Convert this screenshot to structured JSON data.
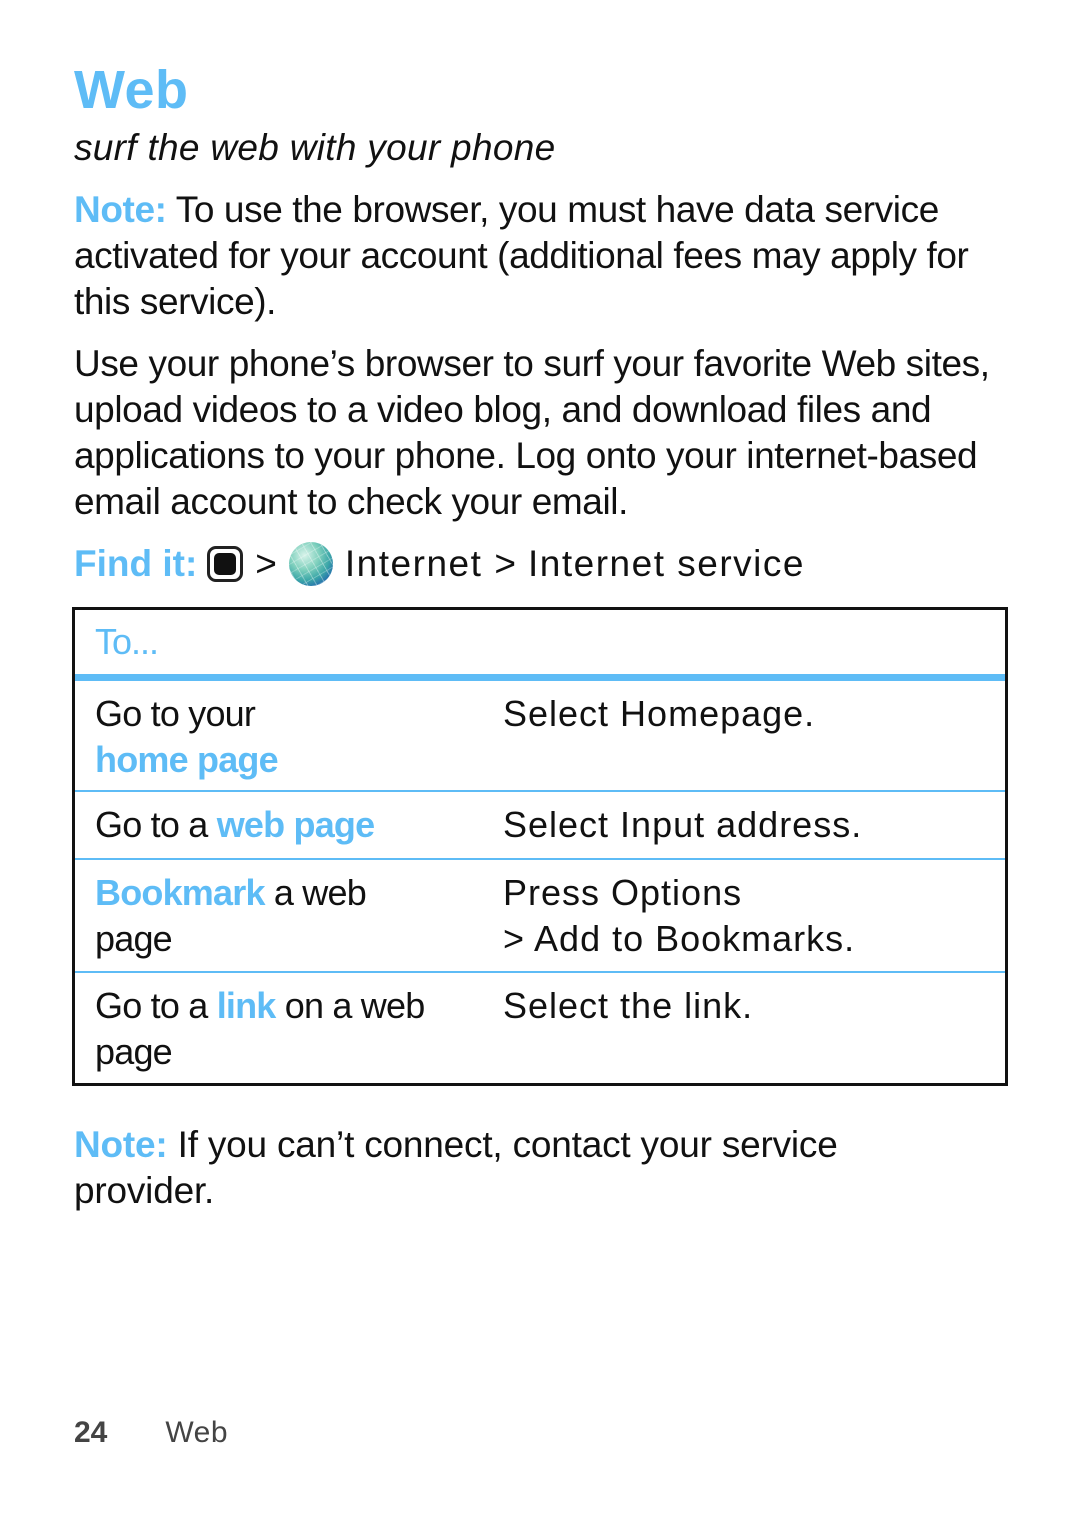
{
  "header": {
    "title": "Web",
    "subtitle": "surf the web with your phone"
  },
  "note1": {
    "label": "Note:",
    "text": " To use the browser, you must have data service activated for your account (additional fees may apply for this service)."
  },
  "intro": {
    "text": "Use your phone’s browser to surf your favorite Web sites, upload videos to a video blog, and download files and applications to your phone. Log onto your internet-based email account to check your email."
  },
  "find_it": {
    "label": "Find it:",
    "icons": [
      "menu-key-icon",
      "globe-icon"
    ],
    "separator": ">",
    "step1": "Internet",
    "step2": "Internet service"
  },
  "table": {
    "header": "To...",
    "rows": [
      {
        "c1_pre": "Go to your ",
        "c1_accent": "home page",
        "c1_post": "",
        "c2": "Select Homepage."
      },
      {
        "c1_pre": "Go to a ",
        "c1_accent": "web page",
        "c1_post": "",
        "c2": "Select Input address."
      },
      {
        "c1_pre": "",
        "c1_accent": "Bookmark",
        "c1_post": " a web page",
        "c2_line1": "Press Options",
        "c2_line2": "> Add to Bookmarks."
      },
      {
        "c1_pre": "Go to a ",
        "c1_accent": "link",
        "c1_post": " on a web page",
        "c2": "Select the link."
      }
    ]
  },
  "note2": {
    "label": "Note:",
    "text": " If you can’t connect, contact your service provider."
  },
  "footer": {
    "page_number": "24",
    "section": "Web"
  },
  "colors": {
    "accent": "#5ebcf6",
    "text": "#111111",
    "footer_text": "#444444"
  }
}
